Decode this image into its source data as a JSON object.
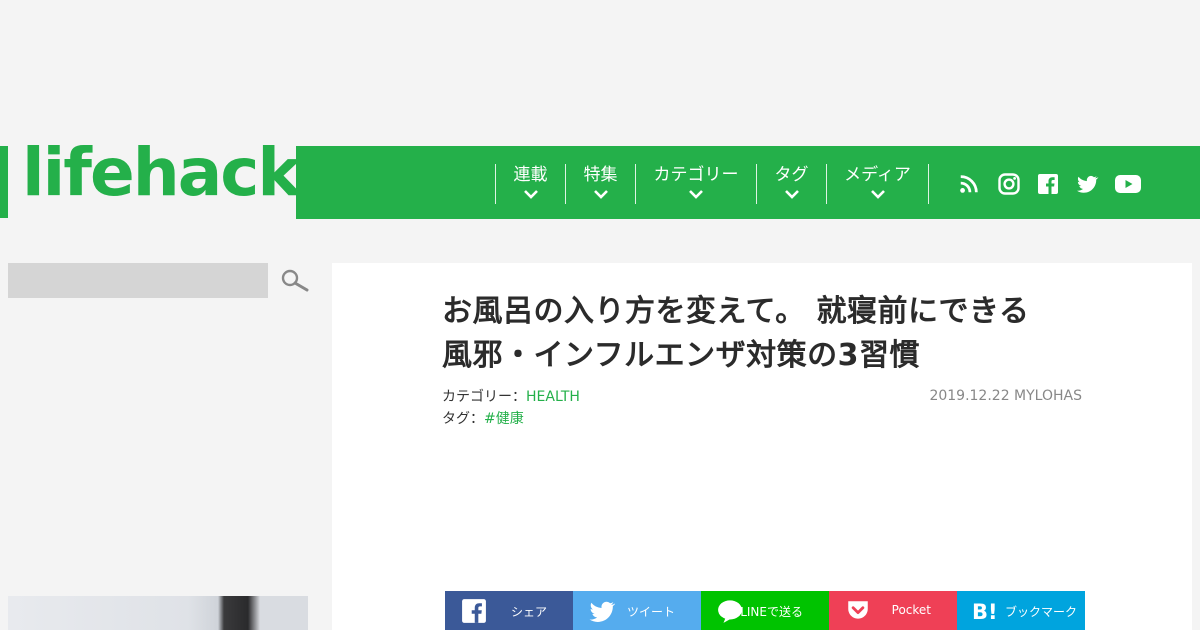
{
  "header": {
    "logo": "lifehacker",
    "nav": [
      {
        "label": "連載"
      },
      {
        "label": "特集"
      },
      {
        "label": "カテゴリー"
      },
      {
        "label": "タグ"
      },
      {
        "label": "メディア"
      }
    ],
    "social": [
      "rss-icon",
      "instagram-icon",
      "facebook-icon",
      "twitter-icon",
      "youtube-icon"
    ],
    "brand_color": "#24b04a"
  },
  "sidebar": {
    "search_placeholder": ""
  },
  "article": {
    "title_line1": "お風呂の入り方を変えて。 就寝前にできる",
    "title_line2": "風邪・インフルエンザ対策の3習慣",
    "category_label": "カテゴリー：",
    "category_value": "HEALTH",
    "tag_label": "タグ：",
    "tag_value": "#健康",
    "date_author": "2019.12.22 MYLOHAS"
  },
  "share": [
    {
      "label": "シェア",
      "color": "#3b5998",
      "icon": "facebook-icon"
    },
    {
      "label": "ツイート",
      "color": "#55acee",
      "icon": "twitter-icon"
    },
    {
      "label": "LINEで送る",
      "color": "#00c300",
      "icon": "line-icon"
    },
    {
      "label": "Pocket",
      "color": "#ef4056",
      "icon": "pocket-icon"
    },
    {
      "label": "ブックマーク",
      "color": "#00a4de",
      "icon": "hatena-bookmark-icon"
    }
  ]
}
